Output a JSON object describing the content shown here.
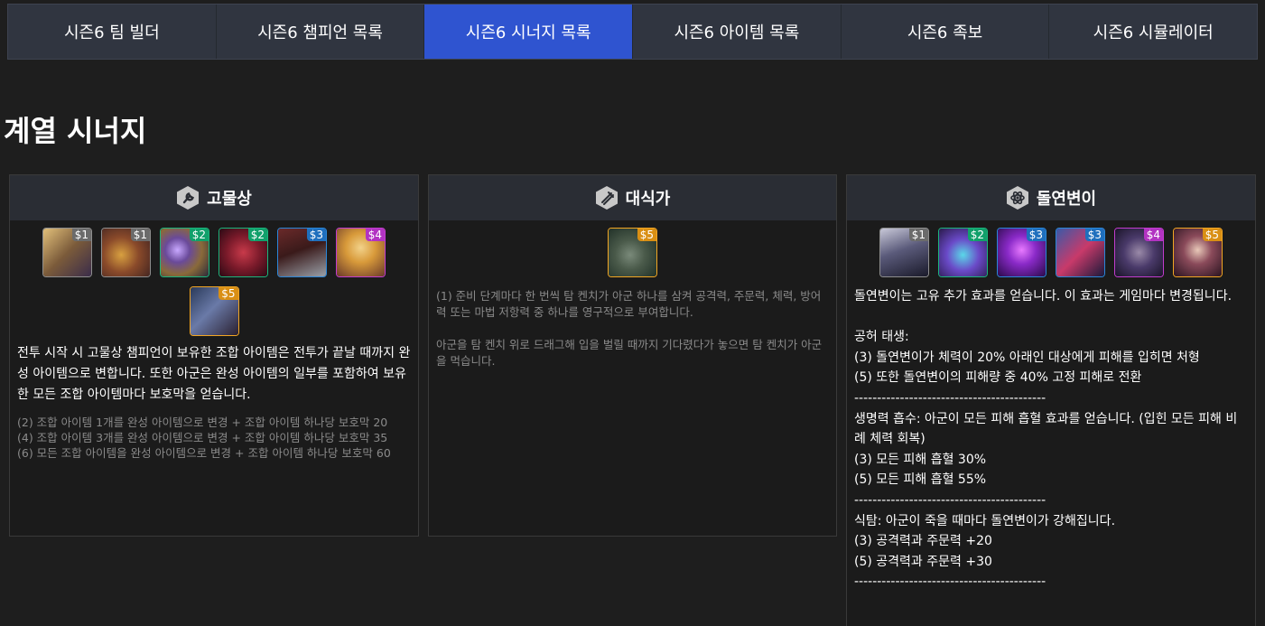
{
  "nav": {
    "tabs": [
      {
        "label": "시즌6 팀 빌더"
      },
      {
        "label": "시즌6 챔피언 목록"
      },
      {
        "label": "시즌6 시너지 목록"
      },
      {
        "label": "시즌6 아이템 목록"
      },
      {
        "label": "시즌6 족보"
      },
      {
        "label": "시즌6 시뮬레이터"
      }
    ],
    "active_index": 2
  },
  "section_title": "계열 시너지",
  "colors": {
    "active_tab": "#2f54d0",
    "cost_1": "#6b6b6b",
    "cost_2": "#11a06b",
    "cost_3": "#1f6fbd",
    "cost_4": "#b233c2",
    "cost_5": "#d98f14"
  },
  "cards": [
    {
      "title": "고물상",
      "icon": "wrench-icon",
      "champion_costs": [
        "$1",
        "$1",
        "$2",
        "$2",
        "$3",
        "$4",
        "$5"
      ],
      "description": "전투 시작 시 고물상 챔피언이 보유한 조합 아이템은 전투가 끝날 때까지 완성 아이템으로 변합니다. 또한 아군은 완성 아이템의 일부를 포함하여 보유한 모든 조합 아이템마다 보호막을 얻습니다.",
      "effects": [
        "(2) 조합 아이템 1개를 완성 아이템으로 변경 + 조합 아이템 하나당 보호막 20",
        "(4) 조합 아이템 3개를 완성 아이템으로 변경 + 조합 아이템 하나당 보호막 35",
        "(6) 모든 조합 아이템을 완성 아이템으로 변경 + 조합 아이템 하나당 보호막 60"
      ]
    },
    {
      "title": "대식가",
      "icon": "fork-knife-icon",
      "champion_costs": [
        "$5"
      ],
      "effect_1": "(1) 준비 단계마다 한 번씩 탐 켄치가 아군 하나를 삼켜 공격력, 주문력, 체력, 방어력 또는 마법 저항력 중 하나를 영구적으로 부여합니다.",
      "effect_2": "아군을 탐 켄치 위로 드래그해 입을 벌릴 때까지 기다렸다가 놓으면 탐 켄치가 아군을 먹습니다."
    },
    {
      "title": "돌연변이",
      "icon": "atom-icon",
      "champion_costs": [
        "$1",
        "$2",
        "$3",
        "$3",
        "$4",
        "$5"
      ],
      "body": "돌연변이는 고유 추가 효과를 얻습니다. 이 효과는 게임마다 변경됩니다.\n\n공허 태생:\n(3) 돌연변이가 체력이 20% 아래인 대상에게 피해를 입히면 처형\n(5) 또한 돌연변이의 피해량 중 40% 고정 피해로 전환\n------------------------------------------\n생명력 흡수: 아군이 모든 피해 흡혈 효과를 얻습니다. (입힌 모든 피해 비례 체력 회복)\n(3) 모든 피해 흡혈 30%\n(5) 모든 피해 흡혈 55%\n------------------------------------------\n식탐: 아군이 죽을 때마다 돌연변이가 강해집니다.\n(3) 공격력과 주문력 +20\n(5) 공격력과 주문력 +30\n------------------------------------------"
    }
  ]
}
